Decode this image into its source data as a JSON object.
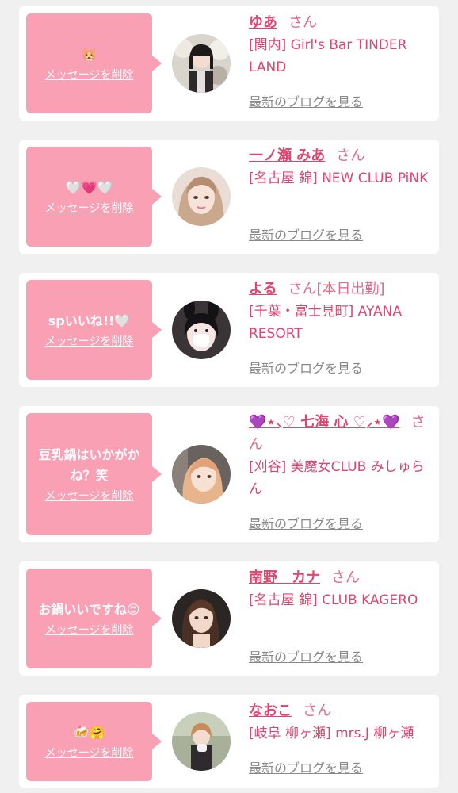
{
  "cards": [
    {
      "message": "🐹",
      "delete_label": "メッセージを削除",
      "name": "ゆあ",
      "suffix": "さん",
      "extra": "",
      "shop": "[関内] Girl's Bar TINDER LAND",
      "blog_label": "最新のブログを見る"
    },
    {
      "message": "🤍💗🤍",
      "delete_label": "メッセージを削除",
      "name": "一ノ瀬 みあ",
      "suffix": "さん",
      "extra": "",
      "shop": "[名古屋 錦] NEW CLUB PiNK",
      "blog_label": "最新のブログを見る"
    },
    {
      "message": "spいいね!!🤍",
      "delete_label": "メッセージを削除",
      "name": "よる",
      "suffix": "さん",
      "extra": "[本日出勤]",
      "shop": "[千葉・富士見町] AYANA RESORT",
      "blog_label": "最新のブログを見る"
    },
    {
      "message": "豆乳鍋はいかがかね？笑",
      "delete_label": "メッセージを削除",
      "name": "💜⋆⸜♡ 七海 心 ♡⸝⋆💜",
      "suffix": "さん",
      "extra": "",
      "shop": "[刈谷] 美魔女CLUB みしゅらん",
      "blog_label": "最新のブログを見る"
    },
    {
      "message": "お鍋いいですね😍",
      "delete_label": "メッセージを削除",
      "name": "南野　カナ",
      "suffix": "さん",
      "extra": "",
      "shop": "[名古屋 錦] CLUB KAGERO",
      "blog_label": "最新のブログを見る"
    },
    {
      "message": "🍻🤗",
      "delete_label": "メッセージを削除",
      "name": "なおこ",
      "suffix": "さん",
      "extra": "",
      "shop": "[岐阜 柳ヶ瀬] mrs.J 柳ヶ瀬",
      "blog_label": "最新のブログを見る"
    }
  ]
}
